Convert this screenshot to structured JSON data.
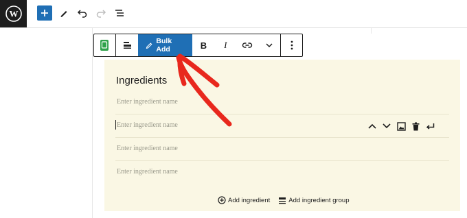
{
  "topbar": {
    "logo_icon": "wordpress-logo",
    "add_icon": "plus-icon",
    "tools_icon": "pencil-icon",
    "undo_icon": "undo-icon",
    "redo_icon": "redo-icon",
    "list_view_icon": "list-view-icon"
  },
  "block_toolbar": {
    "block_type_icon": "recipe-card-icon",
    "align_icon": "align-icon",
    "bulk_add_label": "Bulk Add",
    "bulk_add_icon": "pencil-icon",
    "bold_label": "B",
    "italic_label": "I",
    "link_icon": "link-icon",
    "more_icon": "chevron-down-icon",
    "options_icon": "more-vertical-icon"
  },
  "recipe": {
    "title": "Ingredients",
    "ingredients": [
      {
        "placeholder": "Enter ingredient name"
      },
      {
        "placeholder": "Enter ingredient name"
      },
      {
        "placeholder": "Enter ingredient name"
      },
      {
        "placeholder": "Enter ingredient name"
      }
    ],
    "row_actions": [
      "move-up-icon",
      "move-down-icon",
      "image-icon",
      "trash-icon",
      "enter-icon"
    ],
    "add_ingredient_label": "Add ingredient",
    "add_ingredient_group_label": "Add ingredient group"
  },
  "colors": {
    "accent": "#1f6fb5",
    "block_background": "#faf7e4",
    "annotation": "#e8281d",
    "dark": "#1e1e1e"
  }
}
